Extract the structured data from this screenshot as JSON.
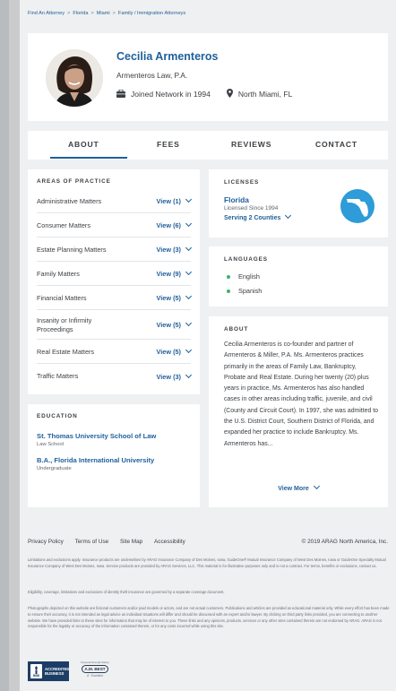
{
  "breadcrumb": [
    "Find An Attorney",
    "Florida",
    "Miami",
    "Family / Immigration Attorneys"
  ],
  "profile": {
    "name": "Cecilia Armenteros",
    "firm": "Armenteros Law, P.A.",
    "joined": "Joined Network in 1994",
    "location": "North Miami, FL"
  },
  "tabs": [
    "ABOUT",
    "FEES",
    "REVIEWS",
    "CONTACT"
  ],
  "areas": {
    "title": "AREAS OF PRACTICE",
    "items": [
      {
        "label": "Administrative Matters",
        "view": "View (1)"
      },
      {
        "label": "Consumer Matters",
        "view": "View (6)"
      },
      {
        "label": "Estate Planning Matters",
        "view": "View (3)"
      },
      {
        "label": "Family Matters",
        "view": "View (9)"
      },
      {
        "label": "Financial Matters",
        "view": "View (5)"
      },
      {
        "label": "Insanity or Infirmity Proceedings",
        "view": "View (5)"
      },
      {
        "label": "Real Estate Matters",
        "view": "View (5)"
      },
      {
        "label": "Traffic Matters",
        "view": "View (3)"
      }
    ]
  },
  "education": {
    "title": "EDUCATION",
    "items": [
      {
        "school": "St. Thomas University School of Law",
        "degree": "Law School"
      },
      {
        "school": "B.A., Florida International University",
        "degree": "Undergraduate"
      }
    ]
  },
  "licenses": {
    "title": "LICENSES",
    "state": "Florida",
    "since": "Licensed Since 1994",
    "serving": "Serving 2 Counties"
  },
  "languages": {
    "title": "LANGUAGES",
    "items": [
      "English",
      "Spanish"
    ]
  },
  "about": {
    "title": "ABOUT",
    "text": "Cecilia Armenteros is co-founder and partner of Armenteros & Miller, P.A. Ms. Armenteros practices primarily in the areas of Family Law, Bankruptcy, Probate and Real Estate. During her twenty (20) plus years in practice, Ms. Armenteros has also handled cases in other areas including traffic, juvenile, and civil (County and Circuit Court). In 1997, she was admitted to the U.S. District Court, Southern District of Florida, and expanded her practice to include Bankruptcy. Ms. Armenteros has...",
    "view_more": "View More"
  },
  "footer": {
    "links": [
      "Privacy Policy",
      "Terms of Use",
      "Site Map",
      "Accessibility"
    ],
    "copyright": "© 2019 ARAG North America, Inc.",
    "legal1": "Limitations and exclusions apply. Insurance products are underwritten by ARAG Insurance Company of Des Moines, Iowa, GuideOne® Mutual Insurance Company of West Des Moines, Iowa or GuideOne Specialty Mutual Insurance Company of West Des Moines, Iowa. Service products are provided by ARAG Services, LLC. This material is for illustrative purposes only and is not a contract. For terms, benefits or exclusions, contact us.",
    "legal2": "Eligibility, coverage, limitations and exclusions of identity theft insurance are governed by a separate coverage document.",
    "legal3": "Photographs depicted on this website are fictional customers and/or paid models or actors, and are not actual customers. Publications and articles are provided as educational material only. While every effort has been made to ensure their accuracy, it is not intended as legal advice as individual situations will differ and should be discussed with an expert and/or lawyer. By clicking on third party links provided, you are connecting to another website. We have provided links to these sites for information that may be of interest to you. These links and any opinions, products, services or any other sites contained therein are not endorsed by ARAG. ARAG is not responsible for the legality or accuracy of the information contained therein, or for any costs incurred while using this site.",
    "bbb": "ACCREDITED BUSINESS",
    "bbb_short": "BBB",
    "ambest_top": "Financial Strength Rating",
    "ambest": "A.M. BEST",
    "ambest_rating": "A · Excellent"
  },
  "colors": {
    "accent": "#1f5f9a",
    "map_circle": "#2e9cd8",
    "dot": "#3cb371"
  }
}
